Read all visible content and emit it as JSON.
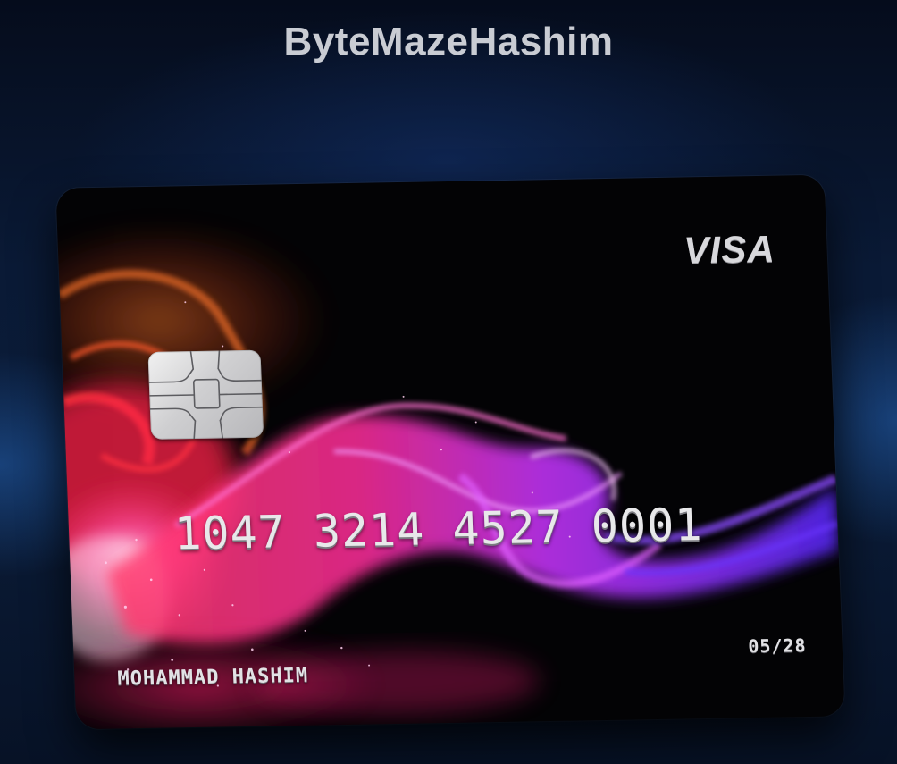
{
  "page": {
    "title": "ByteMazeHashim"
  },
  "card": {
    "network": "VISA",
    "number": "1047 3214 4527 0001",
    "holder": "MOHAMMAD HASHIM",
    "expiry": "05/28"
  },
  "colors": {
    "background": "#0a1a36",
    "title": "#c9ccd3",
    "card_base": "#030305",
    "smoke_orange": "#e8702a",
    "smoke_pink": "#ff2d8a",
    "smoke_magenta": "#d23cff",
    "smoke_violet": "#6a2cff",
    "card_text": "#e8e8ea"
  },
  "icons": {
    "chip": "emv-chip-icon",
    "network_logo": "visa-logo"
  }
}
